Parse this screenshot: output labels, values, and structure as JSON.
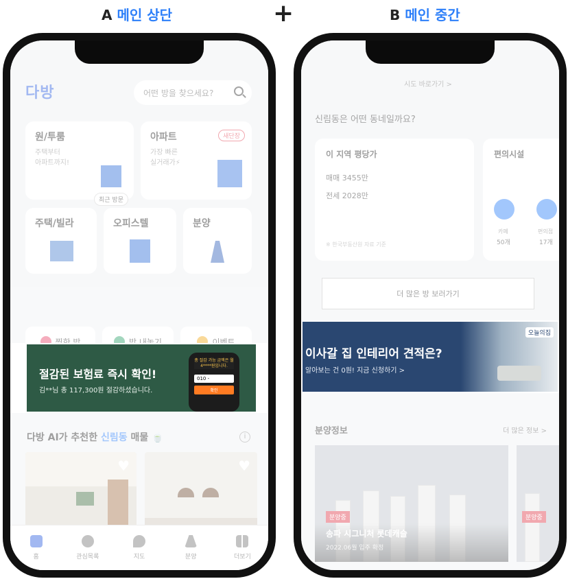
{
  "labels": {
    "a_prefix": "A",
    "a_title": "메인 상단",
    "plus": "+",
    "b_prefix": "B",
    "b_title": "메인 중간"
  },
  "phone_a": {
    "logo": "다방",
    "search_placeholder": "어떤 방을 찾으세요?",
    "cards": [
      {
        "title": "원/투룸",
        "sub1": "주택부터",
        "sub2": "아파트까지!",
        "badge": "최근 방문"
      },
      {
        "title": "아파트",
        "sub1": "가장 빠른",
        "sub2": "실거래가⚡",
        "badge": "새단장"
      },
      {
        "title": "주택/빌라"
      },
      {
        "title": "오피스텔"
      },
      {
        "title": "분양"
      }
    ],
    "quick": [
      "찜한 방",
      "방 내놓기",
      "이벤트"
    ],
    "ad": {
      "title": "절감된 보험료 즉시 확인!",
      "sub": "김**님 총 117,300원 절감하셨습니다.",
      "phone_msg": "총 절감 가능 금액은 월 4****원입니다.",
      "phone_input": "010 -",
      "phone_btn": "확인"
    },
    "section_title_pre": "다방 AI가 추천한 ",
    "section_title_loc": "신림동",
    "section_title_post": " 매물 🍵",
    "info": "i",
    "heart": "♥",
    "tabs": [
      "홈",
      "관심목록",
      "지도",
      "분양",
      "더보기"
    ]
  },
  "phone_b": {
    "link": "시도 바로가기 >",
    "question": "신림동은 어떤 동네일까요?",
    "price": {
      "title": "이 지역 평당가",
      "sale": "매매 3455만",
      "rent": "전세 2028만",
      "note": "※ 한국부동산원 자료 기준"
    },
    "convenience": {
      "title": "편의시설",
      "label1": "카페",
      "value1": "50개",
      "label2": "편의점",
      "value2": "17개"
    },
    "more_btn": "더 많은 방 보러가기",
    "ad": {
      "title": "이사갈 집 인테리어 견적은?",
      "sub": "알아보는 건 0원! 지금 신청하기 >",
      "brand": "오늘의집"
    },
    "section": "분양정보",
    "section_more": "더 많은 정보 >",
    "apt": {
      "tag": "분양중",
      "name": "송파 시그니처 롯데캐슬",
      "date": "2022.06월 입주 확정"
    }
  },
  "colors": {
    "accent": "#2d7ff9",
    "brand": "#2d5fe0",
    "ad_green": "#2e5a45",
    "ad_navy": "#2a4771",
    "badge_red": "#e03a4a"
  }
}
